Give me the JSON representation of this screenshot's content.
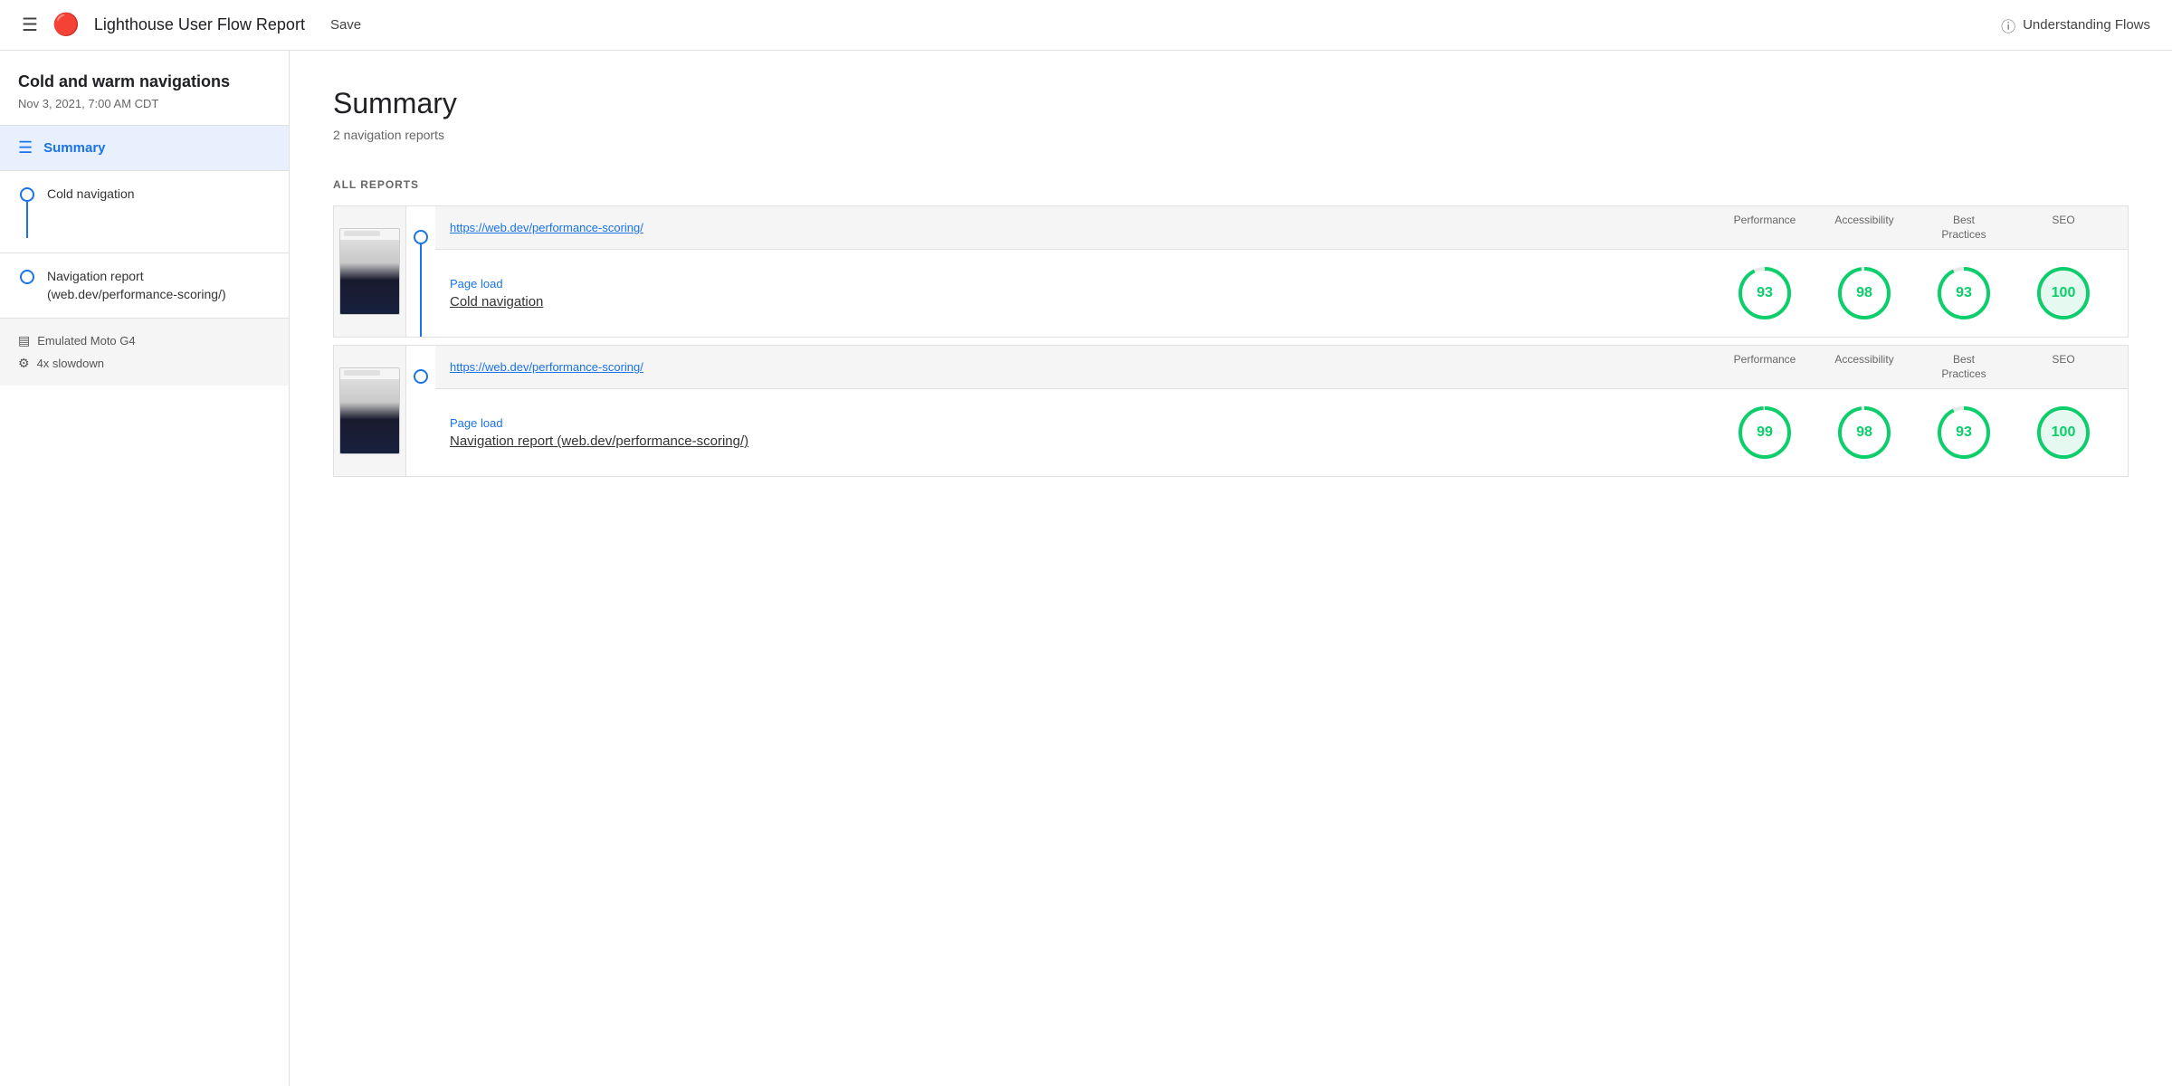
{
  "header": {
    "menu_icon": "☰",
    "logo": "🏠",
    "title": "Lighthouse User Flow Report",
    "save_label": "Save",
    "help_icon": "?",
    "understanding_flows": "Understanding Flows"
  },
  "sidebar": {
    "project": {
      "title": "Cold and warm navigations",
      "date": "Nov 3, 2021, 7:00 AM CDT"
    },
    "summary_item": {
      "label": "Summary"
    },
    "nav_items": [
      {
        "label": "Cold navigation"
      },
      {
        "label": "Navigation report\n(web.dev/performance-scoring/)"
      }
    ],
    "device_info": {
      "device": "Emulated Moto G4",
      "slowdown": "4x slowdown"
    }
  },
  "main": {
    "summary_title": "Summary",
    "summary_subtitle": "2 navigation reports",
    "all_reports_label": "ALL REPORTS",
    "reports": [
      {
        "url": "https://web.dev/performance-scoring/",
        "col_headers": [
          "Performance",
          "Accessibility",
          "Best\nPractices",
          "SEO"
        ],
        "type_label": "Page load",
        "name": "Cold navigation",
        "scores": [
          93,
          98,
          93,
          100
        ]
      },
      {
        "url": "https://web.dev/performance-scoring/",
        "col_headers": [
          "Performance",
          "Accessibility",
          "Best\nPractices",
          "SEO"
        ],
        "type_label": "Page load",
        "name": "Navigation report (web.dev/performance-scoring/)",
        "scores": [
          99,
          98,
          93,
          100
        ]
      }
    ]
  }
}
